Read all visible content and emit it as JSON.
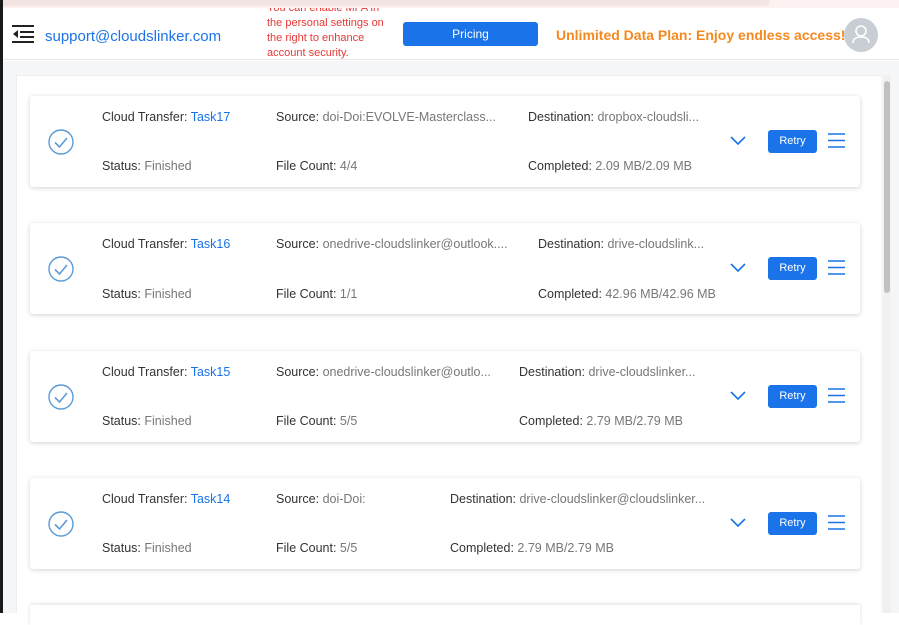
{
  "header": {
    "account_email": "support@cloudslinker.com",
    "notice_lines": [
      "You can enable MFA in",
      "the personal settings on",
      "the right to enhance",
      "account security."
    ],
    "pricing_label": "Pricing",
    "promo_text": "Unlimited Data Plan: Enjoy endless access!"
  },
  "labels": {
    "cloud_transfer": "Cloud Transfer: ",
    "source": "Source: ",
    "destination": "Destination: ",
    "status": "Status: ",
    "file_count": "File Count: ",
    "completed": "Completed: ",
    "retry": "Retry"
  },
  "tasks": [
    {
      "name": "Task17",
      "source": "doi-Doi:EVOLVE-Masterclass...",
      "destination": "dropbox-cloudsli...",
      "status": "Finished",
      "file_count": "4/4",
      "completed": " 2.09 MB/2.09 MB"
    },
    {
      "name": "Task16",
      "source": "onedrive-cloudslinker@outlook....",
      "destination": "drive-cloudslink...",
      "status": "Finished",
      "file_count": "1/1",
      "completed": " 42.96 MB/42.96 MB"
    },
    {
      "name": "Task15",
      "source": "onedrive-cloudslinker@outlo...",
      "destination": "drive-cloudslinker...",
      "status": "Finished",
      "file_count": "5/5",
      "completed": " 2.79 MB/2.79 MB"
    },
    {
      "name": "Task14",
      "source": "doi-Doi:",
      "destination": "drive-cloudslinker@cloudslinker...",
      "status": "Finished",
      "file_count": "5/5",
      "completed": " 2.79 MB/2.79 MB"
    }
  ],
  "colors": {
    "accent": "#1a73e8",
    "promo": "#f5891f",
    "notice": "#e53935",
    "check": "#5b9bd5"
  },
  "icons": {
    "menu": "menu-collapse-icon",
    "avatar": "user-avatar-icon",
    "status": "check-circle-icon",
    "expand": "chevron-down-icon",
    "list": "list-menu-icon"
  }
}
